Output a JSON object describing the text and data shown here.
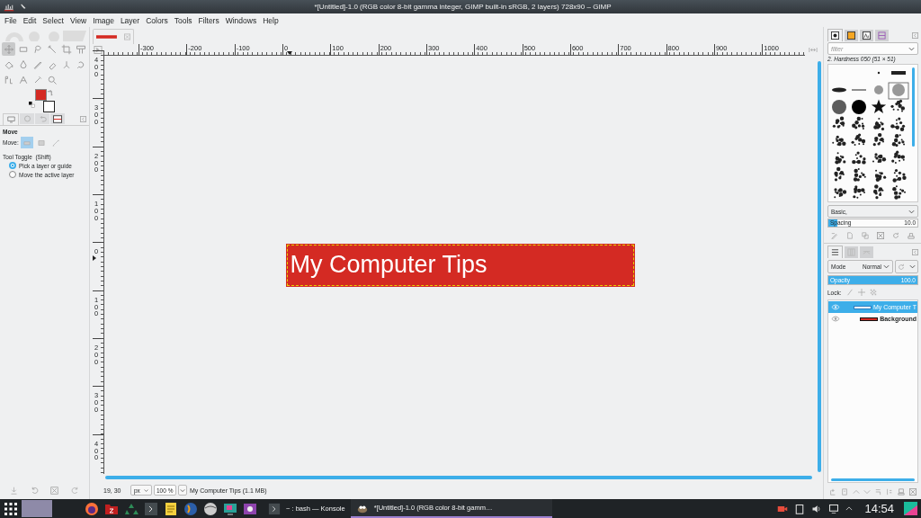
{
  "window": {
    "title": "*[Untitled]-1.0 (RGB color 8-bit gamma integer, GIMP built-in sRGB, 2 layers) 728x90 – GIMP"
  },
  "menu": [
    "File",
    "Edit",
    "Select",
    "View",
    "Image",
    "Layer",
    "Colors",
    "Tools",
    "Filters",
    "Windows",
    "Help"
  ],
  "toolbox": {
    "tools": [
      {
        "kind": "move",
        "selected": true
      },
      {
        "kind": "rect",
        "selected": false
      },
      {
        "kind": "lasso",
        "selected": false
      },
      {
        "kind": "wand",
        "selected": false
      },
      {
        "kind": "crop",
        "selected": false
      },
      {
        "kind": "transform",
        "selected": false
      },
      {
        "kind": "bucket",
        "selected": false
      },
      {
        "kind": "fill",
        "selected": false
      },
      {
        "kind": "pencil",
        "selected": false
      },
      {
        "kind": "eraser",
        "selected": false
      },
      {
        "kind": "clone",
        "selected": false
      },
      {
        "kind": "smudge",
        "selected": false
      },
      {
        "kind": "path",
        "selected": false
      },
      {
        "kind": "text",
        "selected": false
      },
      {
        "kind": "picker",
        "selected": false
      },
      {
        "kind": "zoom",
        "selected": false
      }
    ]
  },
  "tool_options": {
    "title": "Move",
    "move_label": "Move:",
    "modes": [
      {
        "kind": "layer",
        "selected": true
      },
      {
        "kind": "selection",
        "selected": false
      },
      {
        "kind": "path",
        "selected": false
      }
    ],
    "toggle_label": "Tool Toggle  (Shift)",
    "options": [
      {
        "label": "Pick a layer or guide",
        "selected": true
      },
      {
        "label": "Move the active layer",
        "selected": false
      }
    ]
  },
  "canvas": {
    "image_text": "My Computer Tips",
    "hruler": [
      "-300",
      "-200",
      "-100",
      "0",
      "100",
      "200",
      "300",
      "400",
      "500",
      "600",
      "700",
      "800",
      "900",
      "1000"
    ],
    "vruler": [
      "400",
      "300",
      "200",
      "100",
      "0",
      "100",
      "200",
      "300",
      "400"
    ]
  },
  "status_bar": {
    "pointer": "19, 30",
    "unit": "px",
    "zoom": "100 %",
    "info": "My Computer Tips (1.1 MB)"
  },
  "brushes": {
    "filter_placeholder": "filter",
    "brush_name": "2. Hardness 050 (51 × 51)",
    "preset": "Basic,",
    "spacing": {
      "label": "Spacing",
      "value": "10.0",
      "level": 0.1
    }
  },
  "layers": {
    "mode_label": "Mode",
    "mode": "Normal",
    "opacity": {
      "label": "Opacity",
      "value": "100.0",
      "level": 1
    },
    "lock_label": "Lock:",
    "items": [
      {
        "name": "My Computer T",
        "kind": "text",
        "selected": true
      },
      {
        "name": "Background",
        "kind": "fill",
        "selected": false
      }
    ]
  },
  "taskbar": {
    "tasks": [
      {
        "label": "~ : bash — Konsole",
        "kind": "terminal",
        "selected": false
      },
      {
        "label": "*[Untitled]-1.0 (RGB color 8-bit gamm…",
        "kind": "gimp",
        "selected": true
      }
    ],
    "clock": "14:54"
  }
}
